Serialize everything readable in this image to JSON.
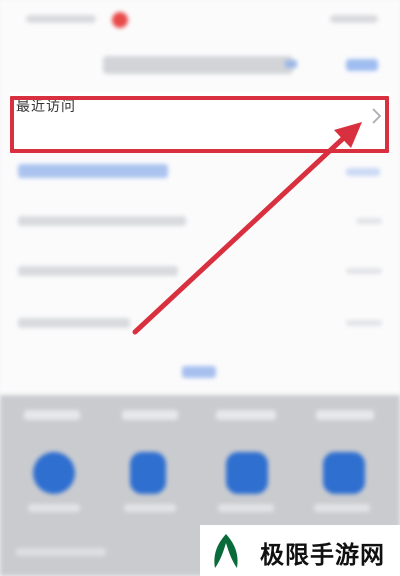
{
  "list": {
    "recent_visits_label": "最近访问"
  },
  "icons": {
    "chevron": "chevron-right-icon",
    "arrow": "arrow-icon",
    "logo": "logo-icon"
  },
  "colors": {
    "highlight": "#d9303f",
    "accent_blue": "#3b78e7",
    "app_blue": "#2f6fd0"
  },
  "watermark": {
    "text": "极限手游网"
  }
}
